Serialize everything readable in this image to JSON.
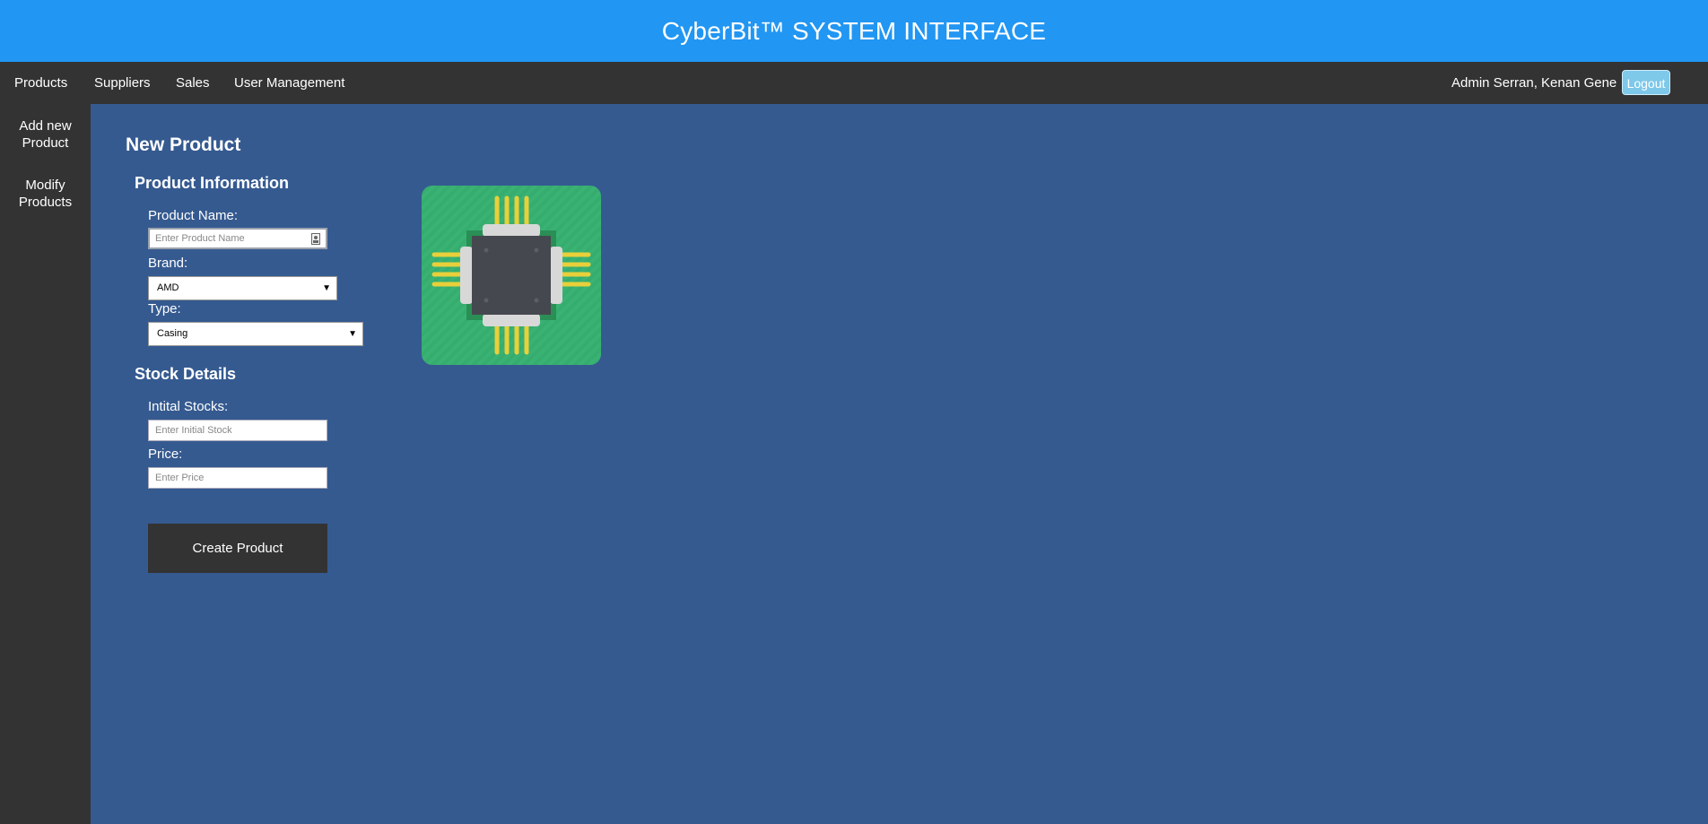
{
  "header": {
    "title": "CyberBit™ SYSTEM INTERFACE"
  },
  "nav": {
    "items": [
      {
        "label": "Products"
      },
      {
        "label": "Suppliers"
      },
      {
        "label": "Sales"
      },
      {
        "label": "User Management"
      }
    ],
    "user": "Admin Serran, Kenan Gene",
    "logout_label": "Logout"
  },
  "sidebar": {
    "items": [
      {
        "line1": "Add new",
        "line2": "Product"
      },
      {
        "line1": "Modify",
        "line2": "Products"
      }
    ]
  },
  "form": {
    "title": "New Product",
    "product_info_heading": "Product Information",
    "product_name_label": "Product Name:",
    "product_name_placeholder": "Enter Product Name",
    "brand_label": "Brand:",
    "brand_value": "AMD",
    "type_label": "Type:",
    "type_value": "Casing",
    "stock_heading": "Stock Details",
    "initial_stock_label": "Intital Stocks:",
    "initial_stock_placeholder": "Enter Initial Stock",
    "price_label": "Price:",
    "price_placeholder": "Enter Price",
    "create_label": "Create Product"
  },
  "image": {
    "icon": "cpu-chip-icon"
  },
  "colors": {
    "header_bg": "#2196f3",
    "nav_bg": "#333333",
    "content_bg": "#355a90",
    "logout_bg": "#7ec8ea",
    "chip_bg": "#35ad6f"
  }
}
